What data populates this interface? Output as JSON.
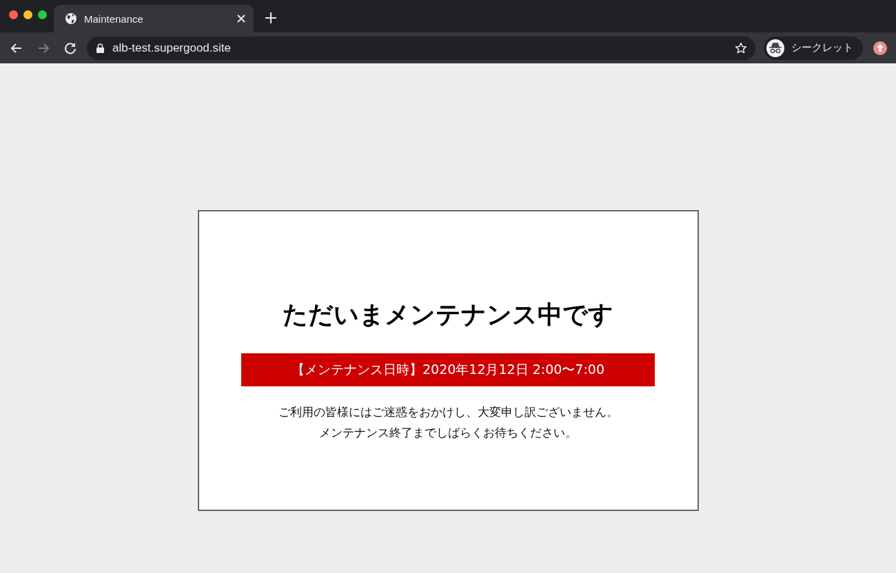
{
  "browser": {
    "tab": {
      "title": "Maintenance",
      "selected": true
    },
    "nav_buttons": [
      {
        "kind": "back",
        "disabled": false
      },
      {
        "kind": "forward",
        "disabled": true
      },
      {
        "kind": "reload",
        "disabled": false
      }
    ],
    "address": "alb-test.supergood.site",
    "profile": {
      "label": "シークレット"
    }
  },
  "page": {
    "heading": "ただいまメンテナンス中です",
    "banner": "【メンテナンス日時】2020年12月12日 2:00〜7:00",
    "message_lines": [
      "ご利用の皆様にはご迷惑をおかけし、大変申し訳ございません。",
      "メンテナンス終了までしばらくお待ちください。"
    ]
  }
}
